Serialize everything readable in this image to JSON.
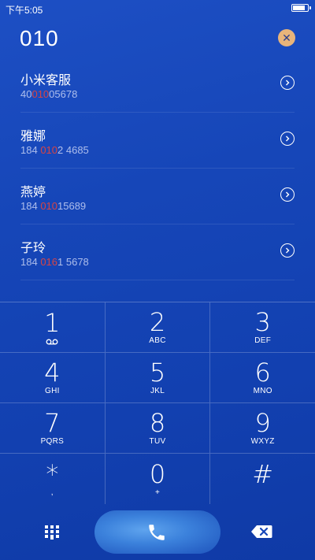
{
  "status": {
    "time": "下午5:05"
  },
  "dialer": {
    "input": "010",
    "clear_icon": "✕"
  },
  "contacts": [
    {
      "name": "小米客服",
      "pre": "40",
      "hl": "010",
      "post": "05678"
    },
    {
      "name": "雅娜",
      "pre": "184 ",
      "hl": "010",
      "post": "2 4685"
    },
    {
      "name": "燕婷",
      "pre": "184 ",
      "hl": "010",
      "post": "15689"
    },
    {
      "name": "子玲",
      "pre": "184 ",
      "hl": "016",
      "post": "1 5678"
    }
  ],
  "keys": [
    {
      "digit": "1",
      "letters": ""
    },
    {
      "digit": "2",
      "letters": "ABC"
    },
    {
      "digit": "3",
      "letters": "DEF"
    },
    {
      "digit": "4",
      "letters": "GHI"
    },
    {
      "digit": "5",
      "letters": "JKL"
    },
    {
      "digit": "6",
      "letters": "MNO"
    },
    {
      "digit": "7",
      "letters": "PQRS"
    },
    {
      "digit": "8",
      "letters": "TUV"
    },
    {
      "digit": "9",
      "letters": "WXYZ"
    },
    {
      "digit": "*",
      "letters": ","
    },
    {
      "digit": "0",
      "letters": "+"
    },
    {
      "digit": "#",
      "letters": ""
    }
  ],
  "colors": {
    "background": "#1646b8",
    "highlight": "#d64545",
    "clear_button": "#e8b47a",
    "call_button": "#3c82dc"
  }
}
